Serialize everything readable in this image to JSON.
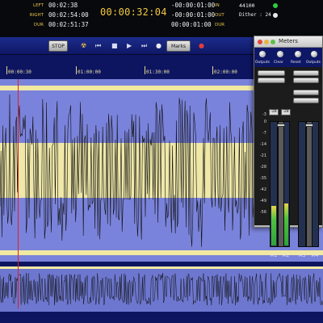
{
  "transport": {
    "left_label": "LEFT",
    "left_time": "00:02:38",
    "right_label": "RIGHT",
    "right_time": "00:02:54:00",
    "dur_label": "DUR",
    "dur_time": "00:02:51:37",
    "current_time": "00:00:32:04",
    "in_time": "-00:00:01:00",
    "in_label": "IN",
    "out_time": "-00:00:01:00",
    "out_label": "OUT",
    "dur2_time": "00:00:01:00",
    "dur2_label": "DUR",
    "sample_rate": "44100",
    "dither": "Dither : 24"
  },
  "toolbar": {
    "stop_button": "STOP",
    "marks_button": "Marks"
  },
  "ruler": {
    "ticks": [
      "00:00:30",
      "01:00:00",
      "01:30:00",
      "02:00:00"
    ]
  },
  "meters_window": {
    "title": "Meters",
    "controls": [
      "Outputs",
      "Clear",
      "Reset",
      "Outputs"
    ],
    "scale": [
      "-3",
      "0",
      "-7",
      "-14",
      "-21",
      "-28",
      "-35",
      "-42",
      "-49",
      "-56"
    ],
    "peaks": [
      "-28",
      "-28"
    ],
    "channels": [
      "M1",
      "M2",
      "M3",
      "M4"
    ],
    "levels": [
      0.32,
      0.34,
      0.0,
      0.0
    ]
  },
  "colors": {
    "waveform_bg": "#7a83db",
    "waveform_band": "#f1e9a2",
    "wave": "#111111",
    "chrome": "#0d1560",
    "timecode": "#f5c940"
  },
  "icons": [
    "biohazard-icon",
    "rewind-icon",
    "stop-icon",
    "play-icon",
    "fast-forward-icon",
    "record-icon",
    "circle-icon"
  ]
}
